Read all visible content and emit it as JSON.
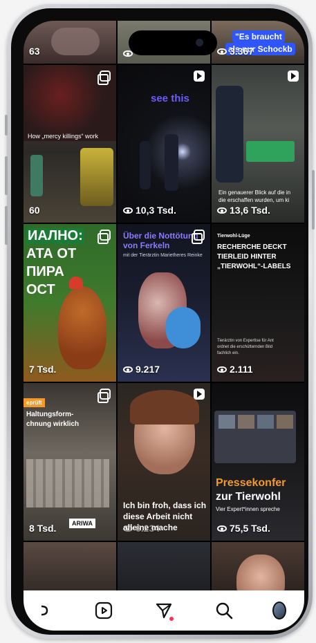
{
  "grid": {
    "row0": [
      {
        "views": "63"
      },
      {
        "views": ""
      },
      {
        "views": "3.367",
        "overlay_text_1": "\"Es braucht",
        "overlay_text_2": "als nur Schockb"
      }
    ],
    "row1": [
      {
        "views": "60",
        "caption": "How „mercy killings“ work"
      },
      {
        "views": "10,3 Tsd.",
        "caption": "see this"
      },
      {
        "views": "13,6 Tsd.",
        "caption_1": "Ein genauerer Blick auf die in",
        "caption_2": "die erschaffen wurden, um ki"
      }
    ],
    "row2": [
      {
        "views": "7 Tsd.",
        "headline_1": "ИАЛНО:",
        "headline_2": "АТА ОТ",
        "headline_3": "ПИРА",
        "headline_4": "ОСТ"
      },
      {
        "views": "9.217",
        "title_1": "Über die Nottötung",
        "title_2": "von Ferkeln",
        "subtitle": "mit der Tierärztin Marietheres Reinke"
      },
      {
        "views": "2.111",
        "kicker": "Tierwohl-Lüge",
        "headline_1": "RECHERCHE DECKT",
        "headline_2": "TIERLEID HINTER",
        "headline_3": "„TIERWOHL“-LABELS",
        "body_1": "Tierärztin von Expertise für Ant",
        "body_2": "ordnet die erschütternden Bild",
        "body_3": "fachlich ein."
      }
    ],
    "row3": [
      {
        "views": "8 Tsd.",
        "tag": "eprüft",
        "headline_1": "Haltungsform-",
        "headline_2": "chnung wirklich",
        "logo": "ARIWA"
      },
      {
        "views": "6.234",
        "caption_1": "Ich bin froh, dass ich",
        "caption_2": "diese Arbeit nicht",
        "caption_3": "alleine mache"
      },
      {
        "views": "75,5 Tsd.",
        "headline_1": "Pressekonfer",
        "headline_2": "zur Tierwohl",
        "sub": "Vier Expert*innen spreche"
      }
    ]
  },
  "tabbar": {
    "items": [
      "home-icon",
      "reels-icon",
      "messages-icon",
      "search-icon",
      "profile-avatar"
    ]
  },
  "colors": {
    "accent_purple": "#6b5cff",
    "notify_red": "#ff2e55",
    "orange": "#f39a2b",
    "highlight_blue": "#2f55ff"
  }
}
